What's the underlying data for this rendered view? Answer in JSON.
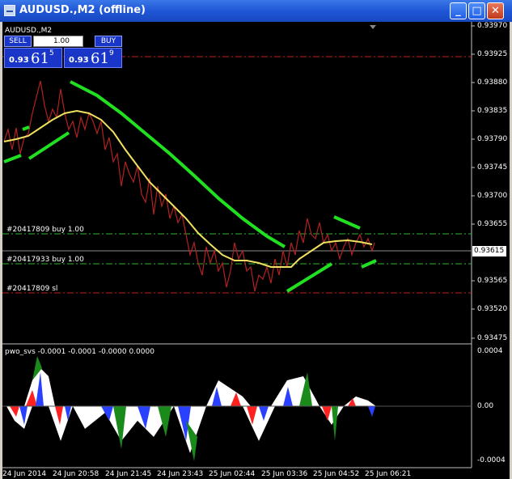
{
  "window": {
    "title": "AUDUSD.,M2 (offline)",
    "minimize": "_",
    "maximize": "□",
    "close": "✕"
  },
  "chart": {
    "symbol_label": "AUDUSD.,M2",
    "price_ticks": [
      "0.93970",
      "0.93925",
      "0.93880",
      "0.93835",
      "0.93790",
      "0.93745",
      "0.93700",
      "0.93655",
      "0.93565",
      "0.93520",
      "0.93475"
    ],
    "current_price": "0.93615",
    "trade_lines": [
      {
        "label": "#20417809 buy 1.00"
      },
      {
        "label": "#20417933 buy 1.00"
      },
      {
        "label": "#20417809 sl"
      }
    ],
    "time_labels": [
      "24 Jun 2014",
      "24 Jun 20:58",
      "24 Jun 21:45",
      "24 Jun 23:43",
      "25 Jun 02:44",
      "25 Jun 03:36",
      "25 Jun 04:52",
      "25 Jun 06:21"
    ]
  },
  "trade_panel": {
    "sell_label": "SELL",
    "buy_label": "BUY",
    "lot_value": "1.00",
    "bid": {
      "big": "0.93",
      "pips": "61",
      "frac": "5"
    },
    "ask": {
      "big": "0.93",
      "pips": "61",
      "frac": "9"
    }
  },
  "indicator": {
    "label": "pwo_svs -0.0001 -0.0001 -0.0000 0.0000",
    "ticks": [
      "0.0004",
      "0.00",
      "-0.0004"
    ]
  }
}
